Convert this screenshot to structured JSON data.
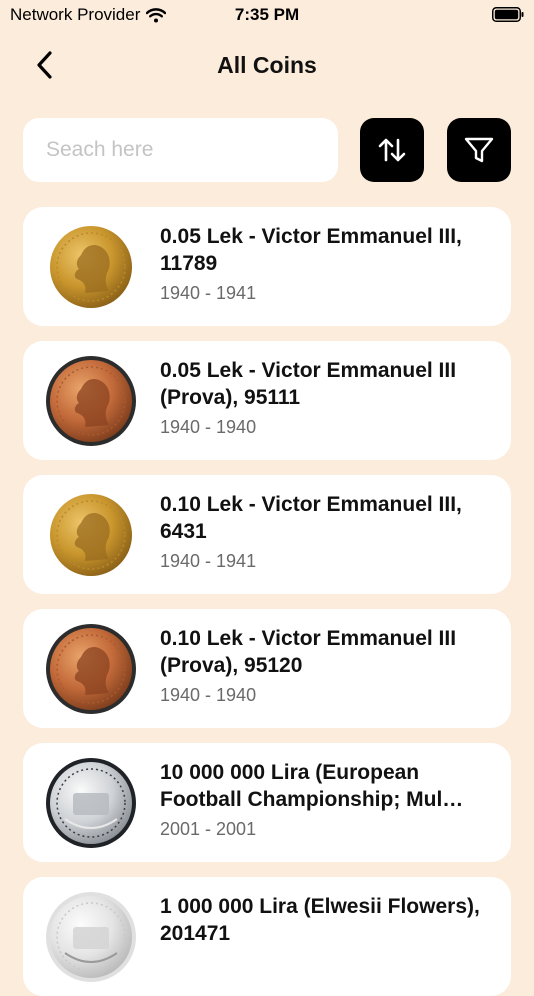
{
  "status_bar": {
    "carrier": "Network Provider",
    "time": "7:35 PM"
  },
  "header": {
    "title": "All Coins"
  },
  "search": {
    "placeholder": "Seach here",
    "value": ""
  },
  "coins": [
    {
      "title": "0.05 Lek - Victor Emmanuel III, 11789",
      "years": "1940 - 1941",
      "coin_style": "gold"
    },
    {
      "title": "0.05 Lek - Victor Emmanuel III (Prova), 95111",
      "years": "1940 - 1940",
      "coin_style": "copper-slab"
    },
    {
      "title": "0.10 Lek - Victor Emmanuel III, 6431",
      "years": "1940 - 1941",
      "coin_style": "gold"
    },
    {
      "title": "0.10 Lek - Victor Emmanuel III (Prova), 95120",
      "years": "1940 - 1940",
      "coin_style": "copper-slab"
    },
    {
      "title": "10 000 000 Lira (European Football Championship; Mul…",
      "years": "2001 - 2001",
      "coin_style": "silver-dark"
    },
    {
      "title": "1 000 000 Lira (Elwesii Flowers), 201471",
      "years": "",
      "coin_style": "silver-light"
    }
  ],
  "colors": {
    "background": "#fcecdc",
    "card": "#ffffff",
    "button": "#000000",
    "subtext": "#6a6a6a"
  }
}
